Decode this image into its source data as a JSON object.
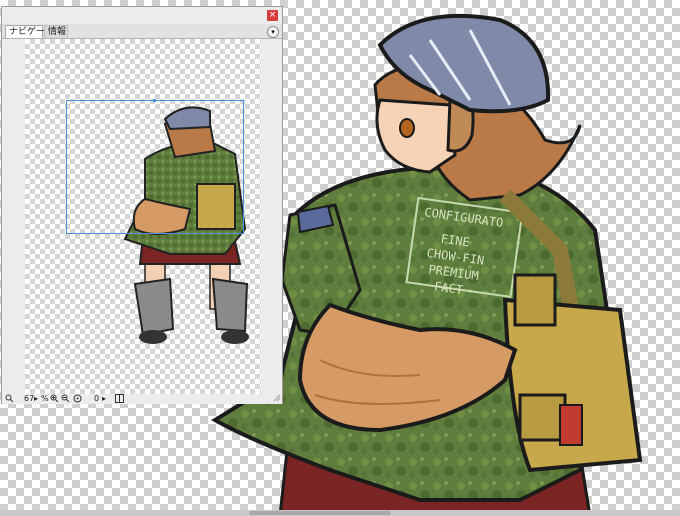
{
  "navigator": {
    "tabs": [
      {
        "label": "ナビゲータ",
        "active": true
      },
      {
        "label": "情報",
        "active": false
      }
    ],
    "close_label": "×",
    "menu_label": "▾",
    "zoom": "67",
    "rotation": "0"
  },
  "artwork_text": {
    "patch_lines": [
      "CONFIGURATO",
      "FINE",
      "CHOW-FIN",
      "PREMIUM",
      "FACT"
    ]
  },
  "colors": {
    "accent_frame": "#4a8ee0",
    "close_red": "#d83d3d",
    "jacket_green": "#5c7a3a",
    "tail_orange": "#d69a64",
    "cap_blue": "#7e8aa8",
    "bag_khaki": "#c7a84a"
  }
}
